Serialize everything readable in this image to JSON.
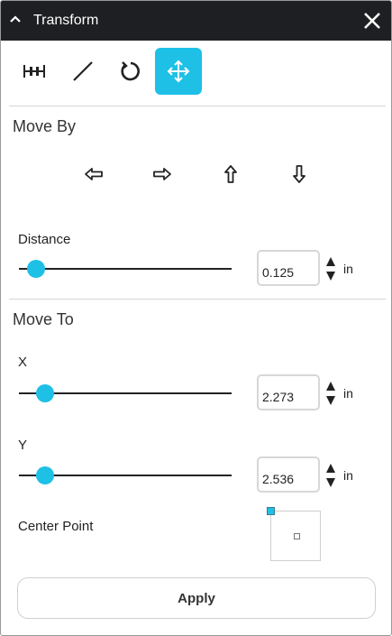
{
  "panel": {
    "title": "Transform",
    "accent_color": "#1ec0e6",
    "titlebar_color": "#1e1f22"
  },
  "toolbar": {
    "tools": [
      {
        "icon": "align-icon",
        "active": false
      },
      {
        "icon": "line-icon",
        "active": false
      },
      {
        "icon": "rotate-icon",
        "active": false
      },
      {
        "icon": "move-icon",
        "active": true
      }
    ]
  },
  "move_by": {
    "title": "Move By",
    "arrows": [
      "left-arrow-icon",
      "right-arrow-icon",
      "up-arrow-icon",
      "down-arrow-icon"
    ],
    "distance": {
      "label": "Distance",
      "value": "0.125",
      "unit": "in",
      "slider_fraction": 0.04
    }
  },
  "move_to": {
    "title": "Move To",
    "x": {
      "label": "X",
      "value": "2.273",
      "unit": "in",
      "slider_fraction": 0.09
    },
    "y": {
      "label": "Y",
      "value": "2.536",
      "unit": "in",
      "slider_fraction": 0.09
    },
    "center_point_label": "Center Point"
  },
  "apply_label": "Apply"
}
